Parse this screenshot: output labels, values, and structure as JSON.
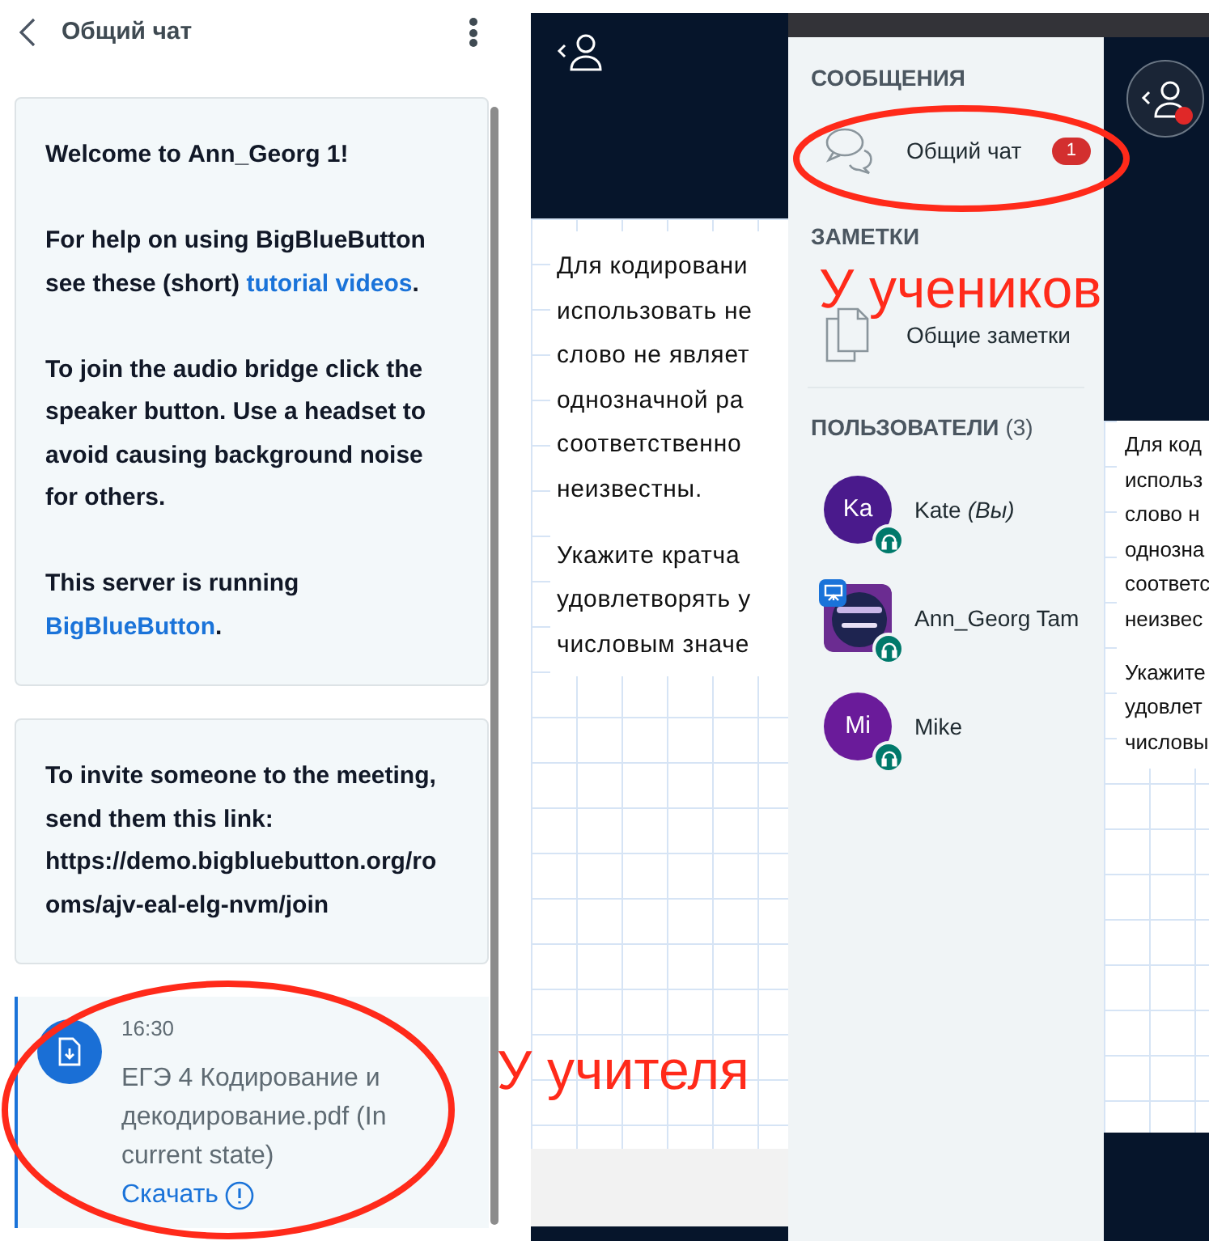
{
  "chat_panel": {
    "title": "Общий чат",
    "messages": [
      {
        "kind": "system",
        "paragraphs": [
          [
            {
              "text": "Welcome to **Ann_Georg 1**!"
            }
          ],
          [
            {
              "text": "For help on using BigBlueButton see these (short) "
            },
            {
              "text": "tutorial videos",
              "link": true
            },
            {
              "text": "."
            }
          ],
          [
            {
              "text": "To join the audio bridge click the speaker button. Use a headset to avoid causing background noise for others."
            }
          ],
          [
            {
              "text": "This server is running "
            },
            {
              "text": "BigBlueButton",
              "link": true
            },
            {
              "text": "."
            }
          ]
        ]
      },
      {
        "kind": "system",
        "paragraphs": [
          [
            {
              "text": "To invite someone to the meeting, send them this link: https://demo.bigbluebutton.org/rooms/ajv-eal-elg-nvm/join"
            }
          ]
        ]
      },
      {
        "kind": "file",
        "time": "16:30",
        "file": "ЕГЭ 4 Кодирование и декодирование.pdf (In current state)",
        "download": "Скачать"
      }
    ]
  },
  "slide_left": {
    "paragraphs": [
      [
        "Для кодировани",
        "использовать не",
        "слово не являет",
        "однозначной ра",
        "соответственно",
        "неизвестны."
      ],
      [
        "Укажите кратча",
        "удовлетворять у",
        "числовым значе"
      ]
    ]
  },
  "sidebar": {
    "sections": [
      {
        "title": "СООБЩЕНИЯ",
        "items": [
          {
            "kind": "chat",
            "label": "Общий чат",
            "badge": "1"
          }
        ]
      },
      {
        "title": "ЗАМЕТКИ",
        "items": [
          {
            "kind": "notes",
            "label": "Общие заметки"
          }
        ]
      }
    ],
    "users_title": "ПОЛЬЗОВАТЕЛИ",
    "users_count": "(3)",
    "users": [
      {
        "kind": "initials",
        "initials": "Ka",
        "name": "Kate",
        "suffix": "(Вы)",
        "color": "#4a1a8c",
        "presenter": false
      },
      {
        "kind": "picture",
        "name": "Ann_Georg Tam",
        "presenter": true
      },
      {
        "kind": "initials",
        "initials": "Mi",
        "name": "Mike",
        "color": "#6a1b9a",
        "presenter": false
      }
    ]
  },
  "slide_right": {
    "notification": true,
    "paragraphs": [
      [
        "Для код",
        "использ",
        "слово н",
        "однозна",
        "соответс",
        "неизвес"
      ],
      [
        "Укажите",
        "удовлет",
        "числовы"
      ]
    ]
  },
  "annotations": [
    {
      "text": "У учеников"
    },
    {
      "text": "У учителя"
    }
  ]
}
